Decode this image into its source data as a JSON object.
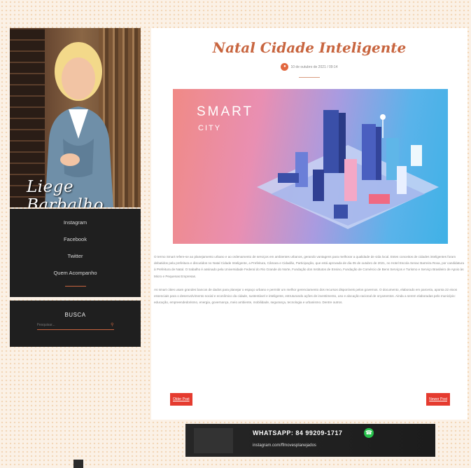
{
  "sidebar": {
    "signature": "Liege Barbalho",
    "menu": [
      {
        "label": "Instagram"
      },
      {
        "label": "Facebook"
      },
      {
        "label": "Twitter"
      },
      {
        "label": "Quem Acompanho"
      }
    ],
    "search": {
      "title": "BUSCA",
      "placeholder": "Pesquisar..."
    }
  },
  "post": {
    "title": "Natal Cidade Inteligente",
    "meta": "10 de outubro de 2021 / 09:14",
    "hero": {
      "text_main": "SMART",
      "text_sub": "CITY"
    },
    "paragraphs": [
      "O termo Smart refere-se ao planejamento urbano e ao ordenamento de serviços em ambientes urbanos, gerando vantagens para melhorar a qualidade de vida local. Estes conceitos de cidades inteligentes foram debatidos pela prefeitura e discutidos no Natal Cidade Inteligente, a Prefeitura, Câmara e Cidadão, Participação, que está aprovada de dia 05 de outubro de 2021, no Hotel Escola Senac Barreira Roxa, por candidatura à Prefeitura de Natal. O trabalho é assinado pela Universidade Federal do Rio Grande do Norte, Fundação dos Institutos de Ensino, Fundação de Comércio de Bens Serviços e Turismo e Serviço Brasileiro de Apoio às Micro e Pequenas Empresas.",
      "As smart cities usam grandes bancos de dados para planejar o espaço urbano e permitir um melhor gerenciamento dos recursos disponíveis pelos governos. O documento, elaborado em parceria, aponta 22 eixos essenciais para o desenvolvimento social e econômico da cidade, sustentável e inteligente, estruturando ações de investimento, uso e alocação racional de orçamentos. Ainda a serem elaboradas pelo município: educação, empreendedorismo, energia, governança, meio ambiente, mobilidade, segurança, tecnologia e urbanismo. Dentre outros."
    ],
    "prev_label": "Older Post",
    "next_label": "Newer Post"
  },
  "banner": {
    "whatsapp": "WHATSAPP: 84 99209-1717",
    "instagram": "instagram.com/ffmovesplanejados"
  },
  "colors": {
    "accent": "#c8653f",
    "button": "#e53b2f",
    "dark": "#1f1f1f"
  }
}
